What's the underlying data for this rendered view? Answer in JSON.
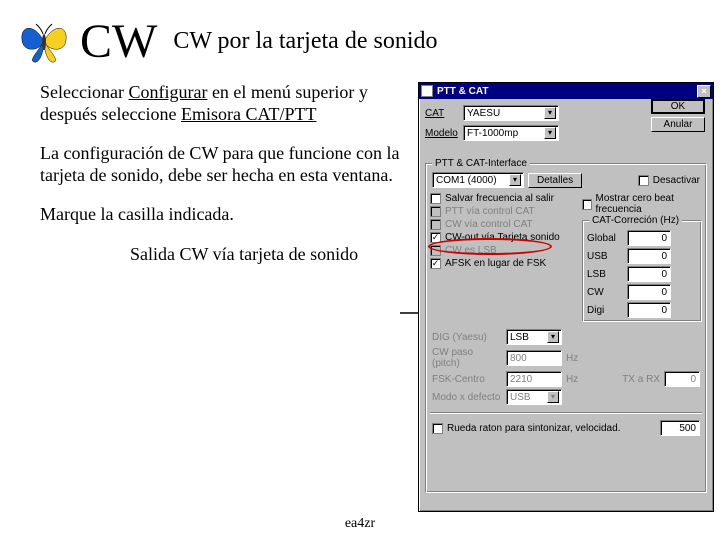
{
  "page": {
    "title_big": "CW",
    "title_sub": "CW por la tarjeta de sonido",
    "footer": "ea4zr",
    "p1a": "Seleccionar ",
    "p1b": "Configurar",
    "p1c": " en el menú superior y después seleccione ",
    "p1d": "Emisora CAT/PTT",
    "p2": "La configuración de CW para que funcione con la  tarjeta de sonido, debe ser hecha en esta ventana.",
    "p3": "Marque la casilla indicada.",
    "p4": "Salida CW vía tarjeta de sonido"
  },
  "dlg": {
    "title": "PTT & CAT",
    "close": "×",
    "labels": {
      "cat": "CAT",
      "modelo": "Modelo"
    },
    "cat_value": "YAESU",
    "modelo_value": "FT-1000mp",
    "ok": "OK",
    "cancel": "Anular",
    "group_title": "PTT & CAT-Interface",
    "port_value": "COM1  (4000)",
    "detalles": "Detalles",
    "cb_desactivar": "Desactivar",
    "cb_salvar": "Salvar frecuencia al salir",
    "cb_mostrar": "Mostrar cero beat frecuencia",
    "cb_ptt_cat": "PTT vía control CAT",
    "cb_cw_cat": "CW vía control CAT",
    "cb_cw_out": "CW-out vía Tarjeta sonido",
    "cb_cw_lsb": "CW es LSB",
    "cb_afsk": "AFSK en lugar de FSK",
    "corr_title": "CAT-Correción (Hz)",
    "lbl_global": "Global",
    "lbl_usb": "USB",
    "lbl_lsb": "LSB",
    "lbl_cw": "CW",
    "lbl_digi": "Digi",
    "val_zero": "0",
    "lbl_dig": "DIG (Yaesu)",
    "dig_value": "LSB",
    "lbl_pitch": "CW paso (pitch)",
    "pitch_value": "800",
    "lbl_fsk": "FSK-Centro",
    "fsk_value": "2210",
    "lbl_modo": "Modo x defecto",
    "modo_value": "USB",
    "hz": "Hz",
    "lbl_txrx": "TX a RX",
    "cb_rueda": "Rueda raton para sintonizar, velocidad.",
    "rueda_value": "500"
  }
}
